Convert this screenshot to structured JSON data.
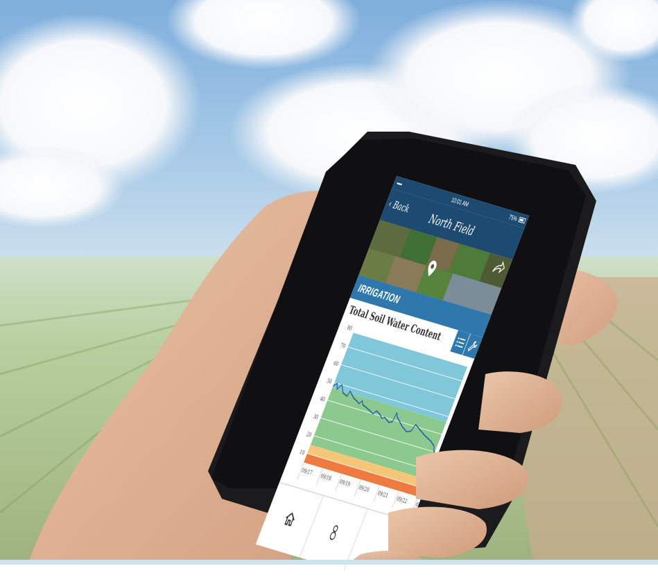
{
  "status_bar": {
    "signal": "•••••",
    "time": "10:01 AM",
    "battery": "75%"
  },
  "nav": {
    "back_label": "‹ Back",
    "title": "North Field"
  },
  "section": {
    "title": "IRRIGATION"
  },
  "icons": {
    "share": "share-icon",
    "location_pin": "map-pin-icon",
    "list": "list-icon",
    "settings": "wrench-icon",
    "home": "home-icon",
    "tab2": "person-icon"
  },
  "colors": {
    "header": "#1c4a70",
    "section": "#2f78ad",
    "zone_high": "#7fc7d9",
    "zone_optimal": "#8cc98f",
    "zone_warning": "#f3c777",
    "zone_critical": "#ee7a3f",
    "line": "#2b5fa6"
  },
  "chart_data": {
    "type": "line",
    "title": "Total Soil Water Content",
    "x": [
      "09/17",
      "09/18",
      "09/19",
      "09/20",
      "09/21",
      "09/22",
      "09/23"
    ],
    "y_ticks": [
      10,
      20,
      30,
      40,
      50,
      60,
      70,
      80
    ],
    "ylim": [
      5,
      80
    ],
    "bands": [
      {
        "from": 5,
        "to": 10,
        "color": "#ee7a3f"
      },
      {
        "from": 10,
        "to": 15,
        "color": "#f3c777"
      },
      {
        "from": 15,
        "to": 47,
        "color": "#8cc98f"
      },
      {
        "from": 47,
        "to": 78,
        "color": "#7fc7d9"
      }
    ],
    "series": [
      {
        "values": [
          [
            0.0,
            48
          ],
          [
            0.15,
            50
          ],
          [
            0.25,
            47
          ],
          [
            0.4,
            50
          ],
          [
            0.6,
            46
          ],
          [
            0.85,
            45
          ],
          [
            0.9,
            48
          ],
          [
            1.0,
            47
          ],
          [
            1.2,
            45
          ],
          [
            1.4,
            44
          ],
          [
            1.55,
            43
          ],
          [
            1.65,
            45
          ],
          [
            1.75,
            43
          ],
          [
            2.0,
            42
          ],
          [
            2.2,
            41
          ],
          [
            2.4,
            40
          ],
          [
            2.5,
            42
          ],
          [
            2.7,
            41
          ],
          [
            2.9,
            39
          ],
          [
            3.0,
            40
          ],
          [
            3.3,
            38
          ],
          [
            3.45,
            39
          ],
          [
            3.5,
            44
          ],
          [
            3.6,
            42
          ],
          [
            3.8,
            40
          ],
          [
            4.0,
            38
          ],
          [
            4.3,
            36
          ],
          [
            4.5,
            37
          ],
          [
            4.6,
            41
          ],
          [
            4.9,
            39
          ],
          [
            5.2,
            37
          ],
          [
            5.6,
            35
          ],
          [
            5.85,
            33
          ],
          [
            5.95,
            30
          ],
          [
            6.0,
            30
          ]
        ]
      }
    ]
  }
}
